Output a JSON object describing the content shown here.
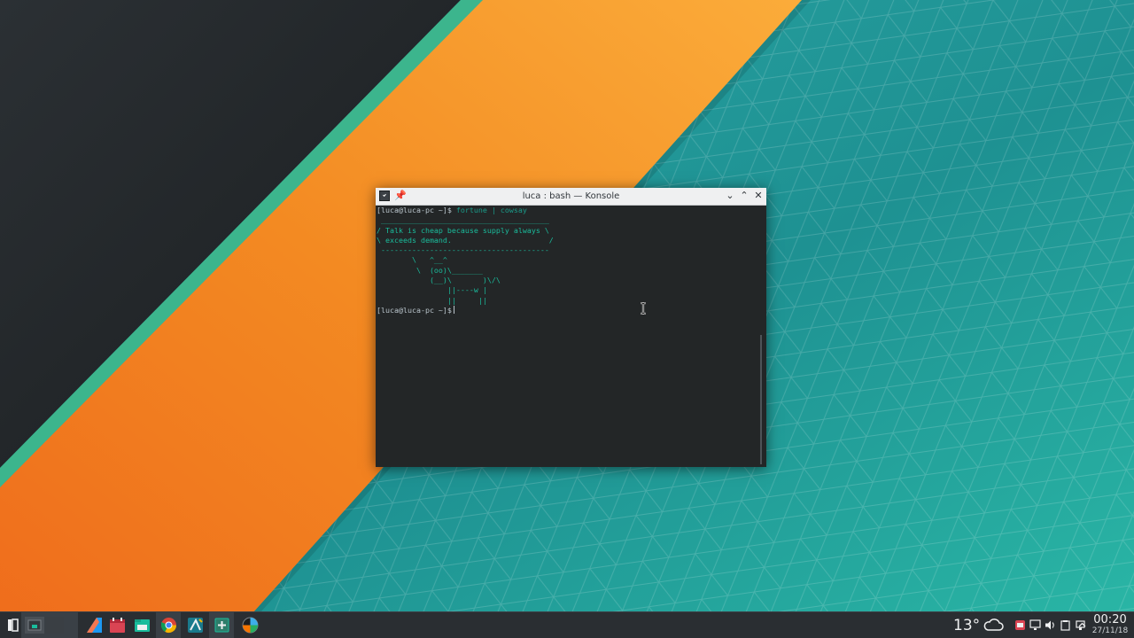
{
  "window": {
    "title": "luca : bash — Konsole",
    "pin_glyph": "📌",
    "minimize_glyph": "⌄",
    "maximize_glyph": "⌃",
    "close_glyph": "✕"
  },
  "terminal": {
    "prompt": "[luca@luca-pc ~]$",
    "command": " fortune | cowsay",
    "cow_lines": [
      " ______________________________________",
      "/ Talk is cheap because supply always \\",
      "\\ exceeds demand.                      /",
      " --------------------------------------",
      "        \\   ^__^",
      "         \\  (oo)\\_______",
      "            (__)\\       )\\/\\",
      "                ||----w |",
      "                ||     ||"
    ],
    "prompt2": "[luca@luca-pc ~]$"
  },
  "taskbar": {
    "items": [
      {
        "name": "application-launcher",
        "icon": "launcher-icon"
      },
      {
        "name": "pager-desktop",
        "icon": "pager-icon"
      },
      {
        "name": "kate",
        "icon": "kate-icon"
      },
      {
        "name": "calendar",
        "icon": "calendar-icon"
      },
      {
        "name": "dolphin",
        "icon": "folder-icon"
      },
      {
        "name": "chromium",
        "icon": "chromium-icon"
      },
      {
        "name": "kdevelop",
        "icon": "kdevelop-icon"
      },
      {
        "name": "add-widget",
        "icon": "add-icon"
      },
      {
        "name": "color-picker",
        "icon": "color-icon"
      }
    ],
    "weather_temp": "13°",
    "clock_time": "00:20",
    "clock_date": "27/11/18"
  },
  "colors": {
    "terminal_bg": "#232627",
    "terminal_text": "#1abc9c",
    "orange_stripe": "#f57f17",
    "teal_stripe": "#3cb58d",
    "teal_bg": "#1f8f8c",
    "taskbar_bg": "#2a2e32"
  }
}
